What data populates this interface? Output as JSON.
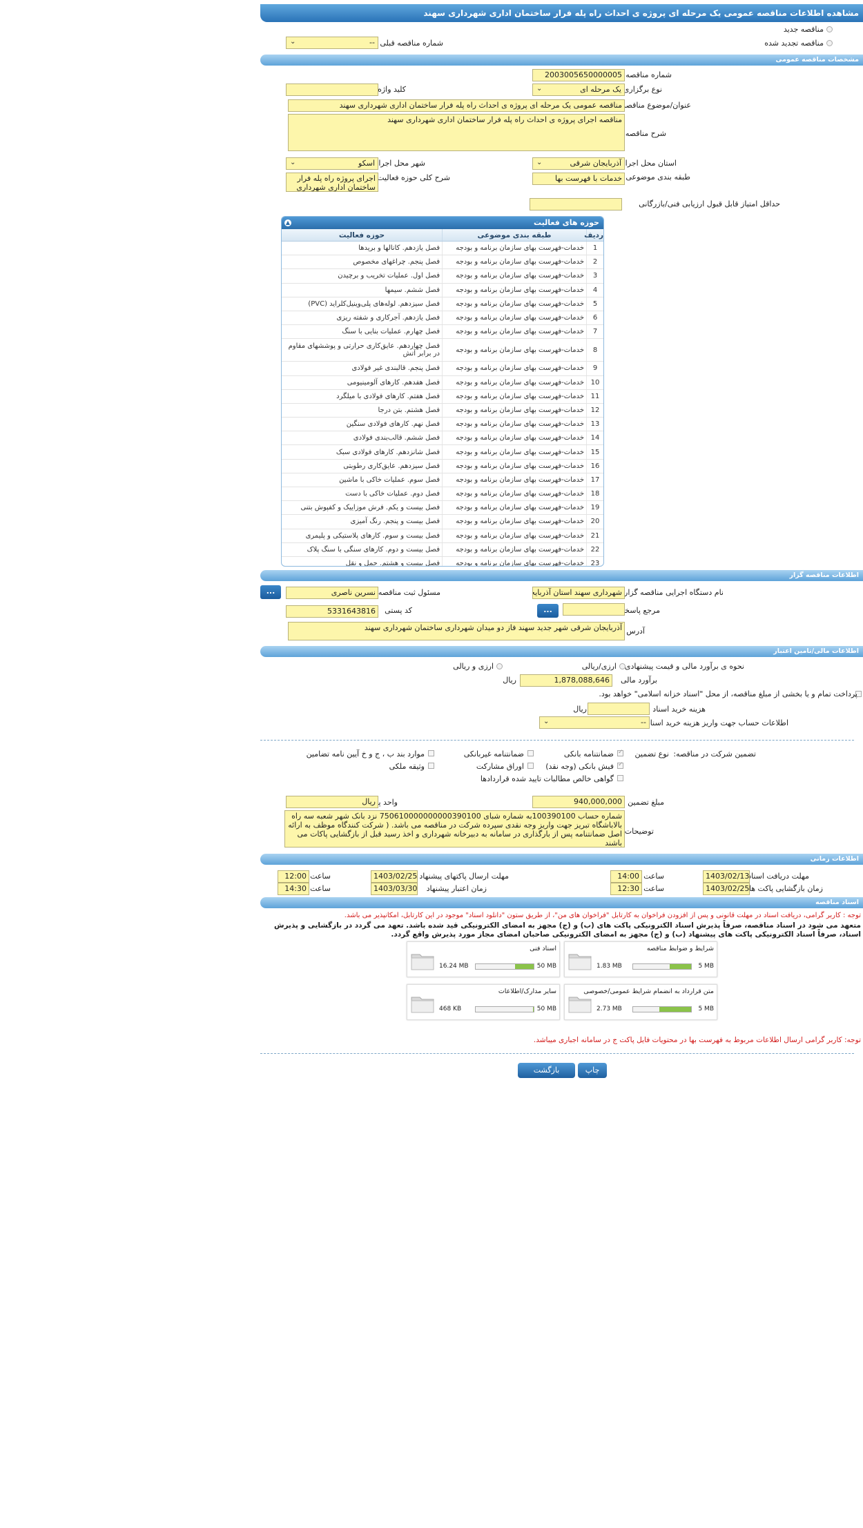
{
  "page_title": "مشاهده اطلاعات مناقصه عمومی یک مرحله ای پروژه ی احداث راه پله فرار ساختمان اداری شهرداری سهند",
  "tender_type": {
    "new": "مناقصه جدید",
    "renewed": "مناقصه تجدید شده",
    "prev_number_label": "شماره مناقصه قبلی",
    "prev_number_value": "--"
  },
  "general": {
    "section_title": "مشخصات مناقصه عمومی",
    "number_label": "شماره مناقصه",
    "number_value": "2003005650000005",
    "holding_label": "نوع برگزاری",
    "holding_value": "یک مرحله ای",
    "keyword_label": "کلید واژه",
    "keyword_value": "",
    "subject_label": "عنوان/موضوع مناقصه",
    "subject_value": "مناقصه عمومی یک مرحله ای پروژه ی احداث راه پله فرار ساختمان اداری شهرداری سهند",
    "desc_label": "شرح مناقصه",
    "desc_value": "مناقصه اجرای پروژه ی احداث راه پله فرار ساختمان اداری شهرداری سهند",
    "province_label": "استان محل اجرا",
    "province_value": "آذربایجان شرقی",
    "city_label": "شهر محل اجرا",
    "city_value": "اسکو",
    "category_label": "طبقه بندی موضوعی",
    "category_value": "خدمات با فهرست بها",
    "activity_desc_label": "شرح کلی حوزه فعالیت",
    "activity_desc_value": "اجرای پروژه راه پله فرار ساختمان اداری شهرداری",
    "min_score_label": "حداقل امتیاز قابل قبول ارزیابی فنی/بازرگانی",
    "min_score_value": ""
  },
  "activities": {
    "title": "حوزه های فعالیت",
    "headers": [
      "ردیف",
      "طبقه بندی موضوعی",
      "حوزه فعالیت"
    ],
    "rows": [
      [
        "1",
        "خدمات-فهرست بهای سازمان برنامه و بودجه",
        "فصل یازدهم. کانالها و بریدها"
      ],
      [
        "2",
        "خدمات-فهرست بهای سازمان برنامه و بودجه",
        "فصل پنجم. چراغهای مخصوص"
      ],
      [
        "3",
        "خدمات-فهرست بهای سازمان برنامه و بودجه",
        "فصل اول. عملیات تخریب و برچیدن"
      ],
      [
        "4",
        "خدمات-فهرست بهای سازمان برنامه و بودجه",
        "فصل ششم. سیمها"
      ],
      [
        "5",
        "خدمات-فهرست بهای سازمان برنامه و بودجه",
        "فصل سیزدهم. لوله‌های پلی‌وینیل‌کلراید (PVC)"
      ],
      [
        "6",
        "خدمات-فهرست بهای سازمان برنامه و بودجه",
        "فصل یازدهم. آجرکاری و شفته ریزی"
      ],
      [
        "7",
        "خدمات-فهرست بهای سازمان برنامه و بودجه",
        "فصل چهارم. عملیات بنایی با سنگ"
      ],
      [
        "8",
        "خدمات-فهرست بهای سازمان برنامه و بودجه",
        "فصل چهاردهم. عایق‌کاری حرارتی و پوششهای مقاوم در برابر آتش"
      ],
      [
        "9",
        "خدمات-فهرست بهای سازمان برنامه و بودجه",
        "فصل پنجم. قالبندی غیر فولادی"
      ],
      [
        "10",
        "خدمات-فهرست بهای سازمان برنامه و بودجه",
        "فصل هفدهم. کارهای آلومینیومی"
      ],
      [
        "11",
        "خدمات-فهرست بهای سازمان برنامه و بودجه",
        "فصل هفتم. کارهای فولادی با میلگرد"
      ],
      [
        "12",
        "خدمات-فهرست بهای سازمان برنامه و بودجه",
        "فصل هشتم. بتن درجا"
      ],
      [
        "13",
        "خدمات-فهرست بهای سازمان برنامه و بودجه",
        "فصل نهم. کارهای فولادی سنگین"
      ],
      [
        "14",
        "خدمات-فهرست بهای سازمان برنامه و بودجه",
        "فصل ششم. قالب‌بندی فولادی"
      ],
      [
        "15",
        "خدمات-فهرست بهای سازمان برنامه و بودجه",
        "فصل شانزدهم. کارهای فولادی سبک"
      ],
      [
        "16",
        "خدمات-فهرست بهای سازمان برنامه و بودجه",
        "فصل سیزدهم. عایق‌کاری رطوبتی"
      ],
      [
        "17",
        "خدمات-فهرست بهای سازمان برنامه و بودجه",
        "فصل سوم. عملیات خاکی با ماشین"
      ],
      [
        "18",
        "خدمات-فهرست بهای سازمان برنامه و بودجه",
        "فصل دوم. عملیات خاکی با دست"
      ],
      [
        "19",
        "خدمات-فهرست بهای سازمان برنامه و بودجه",
        "فصل بیست و یکم. فرش موزاییک و کفپوش بتنی"
      ],
      [
        "20",
        "خدمات-فهرست بهای سازمان برنامه و بودجه",
        "فصل بیست و پنجم. رنگ آمیزی"
      ],
      [
        "21",
        "خدمات-فهرست بهای سازمان برنامه و بودجه",
        "فصل بیست و سوم. کارهای پلاستیکی و پلیمری"
      ],
      [
        "22",
        "خدمات-فهرست بهای سازمان برنامه و بودجه",
        "فصل بیست و دوم. کارهای سنگی با سنگ پلاک"
      ],
      [
        "23",
        "خدمات-فهرست بهای سازمان برنامه و بودجه",
        "فصل بیست و هشتم. حمل و نقل"
      ]
    ]
  },
  "organizer": {
    "section_title": "اطلاعات مناقصه گزار",
    "org_label": "نام دستگاه اجرایی مناقصه گزار",
    "org_value": "شهرداری سهند استان آذربایجان شرقی",
    "resp_label": "مسئول ثبت مناقصه",
    "resp_value": "نسرین ناصری",
    "ref_label": "مرجع پاسخگویی",
    "ref_value": "",
    "postal_label": "کد پستی",
    "postal_value": "5331643816",
    "address_label": "آدرس",
    "address_value": "آذربایجان شرقی شهر جدید سهند فاز دو میدان شهرداری ساختمان شهرداری سهند",
    "dots": "..."
  },
  "finance": {
    "section_title": "اطلاعات مالی/تامین اعتبار",
    "estimate_method_label": "نحوه ی برآورد مالی و قیمت پیشنهادی",
    "opt_rial": "ارزی/ریالی",
    "opt_both": "ارزی و ریالی",
    "estimate_label": "برآورد مالی",
    "estimate_value": "1,878,088,646",
    "estimate_unit": "ریال",
    "treasury_text": "پرداخت تمام و یا بخشی از مبلغ مناقصه، از محل \"اسناد خزانه اسلامی\" خواهد بود.",
    "doc_cost_label": "هزینه خرید اسناد",
    "doc_cost_value": "",
    "doc_cost_unit": "ریال",
    "account_label": "اطلاعات حساب جهت واریز هزینه خرید اسناد",
    "account_value": "--"
  },
  "guarantee": {
    "label": "تضمین شرکت در مناقصه:",
    "type_label": "نوع تضمین",
    "opt1": "ضمانتنامه بانکی",
    "opt2": "ضمانتنامه غیربانکی",
    "opt3": "موارد بند ب ، ج و خ آیین نامه تضامین",
    "opt4": "فیش بانکی (وجه نقد)",
    "opt5": "اوراق مشارکت",
    "opt6": "وثیقه ملکی",
    "opt7": "گواهی خالص مطالبات تایید شده قراردادها",
    "amount_label": "مبلغ تضمین",
    "amount_value": "940,000,000",
    "currency_label": "واحد پول",
    "currency_value": "ریال",
    "notes_label": "توضیحات",
    "notes_value": "شماره حساب 100390100به شماره شبای 750610000000000390100 نزد بانک شهر شعبه سه راه بالاباشگاه تبریز جهت واریز وجه نقدی سپرده شرکت در مناقصه می باشد. ( شرکت کنندگاه موظف به ارائه اصل ضمانتنامه پس از بارگذاری در سامانه به دبیرخانه شهرداری و اخذ رسید قبل از بازگشایی پاکات می باشند"
  },
  "timing": {
    "section_title": "اطلاعات زمانی",
    "doc_deadline_label": "مهلت دریافت اسناد",
    "doc_deadline_date": "1403/02/13",
    "doc_deadline_time": "14:00",
    "submit_deadline_label": "مهلت ارسال پاکتهای پیشنهاد",
    "submit_deadline_date": "1403/02/25",
    "submit_deadline_time": "12:00",
    "opening_label": "زمان بازگشایی پاکت ها",
    "opening_date": "1403/02/25",
    "opening_time": "12:30",
    "validity_label": "زمان اعتبار پیشنهاد",
    "validity_date": "1403/03/30",
    "validity_time": "14:30",
    "time_label": "ساعت"
  },
  "docs": {
    "section_title": "اسناد مناقصه",
    "note1": "توجه : کاربر گرامی، دریافت اسناد در مهلت قانونی و پس از افزودن فراخوان به کارتابل \"فراخوان های من\"، از طریق ستون \"دانلود اسناد\" موجود در این کارتابل، امکانپذیر می باشد.",
    "note2": "متعهد می شود در اسناد مناقصه، صرفاً پذیرش اسناد الکترونیکی پاکت های (ب) و (ج) مجهز به امضای الکترونیکی قید شده باشد. تعهد می گردد در بازگشایی و پذیرش اسناد، صرفاً اسناد الکترونیکی پاکت های پیشنهاد (ب) و (ج) مجهز به امضای الکترونیکی صاحبان امضای مجاز مورد پذیرش واقع گردد.",
    "files": [
      {
        "name": "شرایط و ضوابط مناقصه",
        "current": "1.83 MB",
        "max": "5 MB",
        "fill": 0.37
      },
      {
        "name": "اسناد فنی",
        "current": "16.24 MB",
        "max": "50 MB",
        "fill": 0.32
      },
      {
        "name": "متن قرارداد به انضمام شرایط عمومی/خصوصی",
        "current": "2.73 MB",
        "max": "5 MB",
        "fill": 0.55
      },
      {
        "name": "سایر مدارک/اطلاعات",
        "current": "468 KB",
        "max": "50 MB",
        "fill": 0.01
      }
    ],
    "note3": "توجه: کاربر گرامی ارسال اطلاعات مربوط به فهرست بها در محتویات فایل پاکت ج در سامانه اجباری میباشد."
  },
  "buttons": {
    "back": "بازگشت",
    "print": "چاپ"
  },
  "colors": {
    "accent": "#2a73b7",
    "field": "#fdf6ab",
    "note": "#d21d1d"
  }
}
